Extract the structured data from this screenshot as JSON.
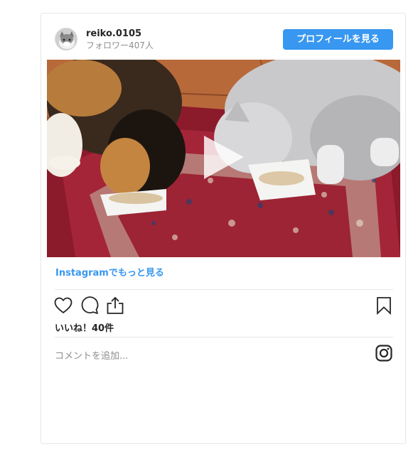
{
  "header": {
    "username": "reiko.0105",
    "followers": "フォロワー407人",
    "profile_button": "プロフィールを見る"
  },
  "media": {
    "type": "video",
    "play_icon": "play-icon"
  },
  "links": {
    "view_more": "Instagramでもっと見る"
  },
  "actions": {
    "like_icon": "heart-icon",
    "comment_icon": "comment-icon",
    "share_icon": "share-icon",
    "save_icon": "bookmark-icon"
  },
  "likes": "いいね！40件",
  "comment_placeholder": "コメントを追加...",
  "colors": {
    "accent": "#3897f0",
    "text": "#262626",
    "muted": "#8e8e8e",
    "border": "#e6e6e6"
  }
}
